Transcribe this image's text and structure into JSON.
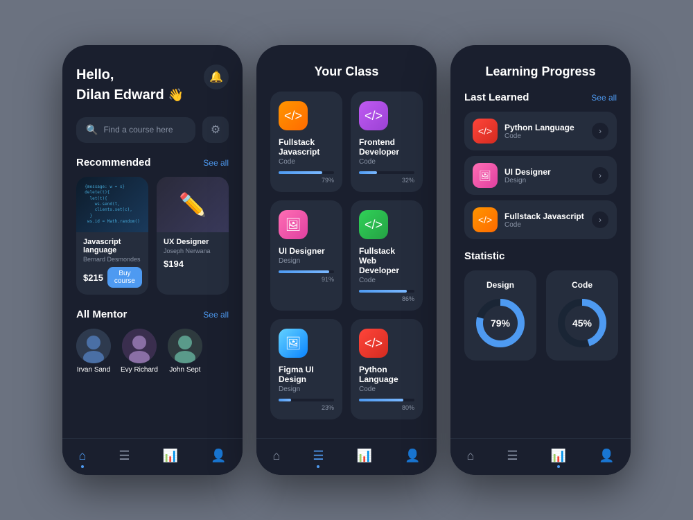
{
  "app": {
    "bg_color": "#6b7280"
  },
  "phone1": {
    "greeting": "Hello,",
    "name": "Dilan Edward",
    "wave": "👋",
    "search_placeholder": "Find a course here",
    "recommended_title": "Recommended",
    "see_all": "See all",
    "rec_cards": [
      {
        "title": "Javascript language",
        "author": "Bernard Desmondes",
        "price": "$215",
        "buy_label": "Buy course",
        "type": "code"
      },
      {
        "title": "UX Designer",
        "author": "Joseph Nerwana",
        "price": "$194",
        "type": "ux"
      }
    ],
    "mentor_title": "All Mentor",
    "mentors": [
      {
        "name": "Irvan Sand",
        "emoji": "👨"
      },
      {
        "name": "Evy Richard",
        "emoji": "👩"
      },
      {
        "name": "John Sept",
        "emoji": "👨‍💼"
      }
    ],
    "nav_items": [
      "🏠",
      "☰",
      "📊",
      "👤"
    ]
  },
  "phone2": {
    "title": "Your Class",
    "classes": [
      {
        "name": "Fullstack Javascript",
        "cat": "Code",
        "pct": 79,
        "icon_class": "icon-orange"
      },
      {
        "name": "Frontend Developer",
        "cat": "Code",
        "pct": 32,
        "icon_class": "icon-purple"
      },
      {
        "name": "UI Designer",
        "cat": "Design",
        "pct": 91,
        "icon_class": "icon-pink"
      },
      {
        "name": "Fullstack Web Developer",
        "cat": "Code",
        "pct": 86,
        "icon_class": "icon-green"
      },
      {
        "name": "Figma UI Design",
        "cat": "Design",
        "pct": 23,
        "icon_class": "icon-blue2"
      },
      {
        "name": "Python Language",
        "cat": "Code",
        "pct": 80,
        "icon_class": "icon-red"
      }
    ],
    "nav_items": [
      "🏠",
      "☰",
      "📊",
      "👤"
    ]
  },
  "phone3": {
    "title": "Learning Progress",
    "last_learned_title": "Last Learned",
    "see_all": "See all",
    "last_learned": [
      {
        "name": "Python Language",
        "cat": "Code",
        "icon_class": "icon-red"
      },
      {
        "name": "UI Designer",
        "cat": "Design",
        "icon_class": "icon-pink"
      },
      {
        "name": "Fullstack Javascript",
        "cat": "Code",
        "icon_class": "icon-orange"
      }
    ],
    "statistic_title": "Statistic",
    "stats": [
      {
        "label": "Design",
        "pct": 79,
        "color": "#4e9af1"
      },
      {
        "label": "Code",
        "pct": 45,
        "color": "#4e9af1"
      }
    ],
    "nav_items": [
      "🏠",
      "☰",
      "📊",
      "👤"
    ]
  }
}
